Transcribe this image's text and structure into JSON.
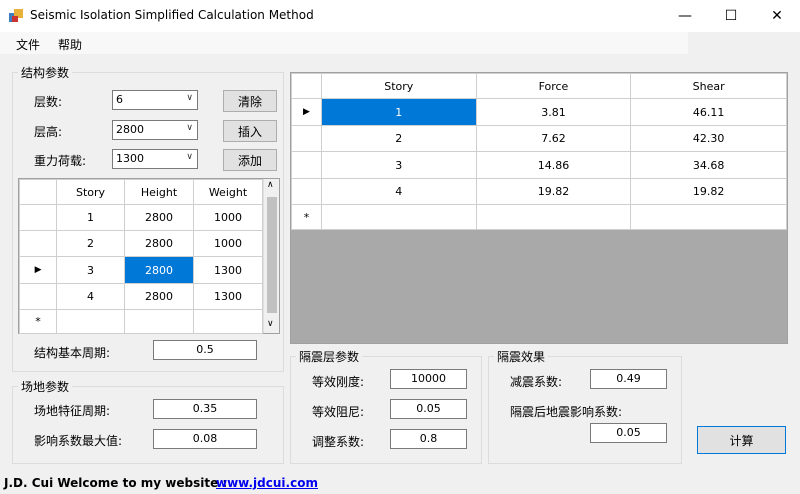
{
  "window": {
    "title": "Seismic Isolation Simplified Calculation Method",
    "minimize": "—",
    "maximize": "☐",
    "close": "✕"
  },
  "menu": {
    "file": "文件",
    "help": "帮助"
  },
  "structure": {
    "group_title": "结构参数",
    "floors_label": "层数:",
    "floors_value": "6",
    "height_label": "层高:",
    "height_value": "2800",
    "load_label": "重力荷载:",
    "load_value": "1300",
    "clear_button": "清除",
    "insert_button": "插入",
    "add_button": "添加",
    "grid": {
      "headers": [
        "Story",
        "Height",
        "Weight"
      ],
      "rows": [
        [
          "1",
          "2800",
          "1000"
        ],
        [
          "2",
          "2800",
          "1000"
        ],
        [
          "3",
          "2800",
          "1300"
        ],
        [
          "4",
          "2800",
          "1300"
        ]
      ],
      "new_row_marker": "*",
      "current_row_marker": "▶"
    },
    "period_label": "结构基本周期:",
    "period_value": "0.5"
  },
  "site": {
    "group_title": "场地参数",
    "char_period_label": "场地特征周期:",
    "char_period_value": "0.35",
    "max_coef_label": "影响系数最大值:",
    "max_coef_value": "0.08"
  },
  "isolation": {
    "group_title": "隔震层参数",
    "stiffness_label": "等效刚度:",
    "stiffness_value": "10000",
    "damping_label": "等效阻尼:",
    "damping_value": "0.05",
    "adjust_label": "调整系数:",
    "adjust_value": "0.8"
  },
  "effect": {
    "group_title": "隔震效果",
    "reduction_label": "减震系数:",
    "reduction_value": "0.49",
    "post_coef_label": "隔震后地震影响系数:",
    "post_coef_value": "0.05"
  },
  "calc_button": "计算",
  "result_grid": {
    "headers": [
      "Story",
      "Force",
      "Shear"
    ],
    "rows": [
      [
        "1",
        "3.81",
        "46.11"
      ],
      [
        "2",
        "7.62",
        "42.30"
      ],
      [
        "3",
        "14.86",
        "34.68"
      ],
      [
        "4",
        "19.82",
        "19.82"
      ]
    ],
    "new_row_marker": "*",
    "current_row_marker": "▶"
  },
  "footer": {
    "text": "J.D. Cui   Welcome to my website :",
    "link": "www.jdcui.com"
  },
  "colors": {
    "selection": "#0078d7",
    "grid_empty": "#a9a9a9"
  }
}
